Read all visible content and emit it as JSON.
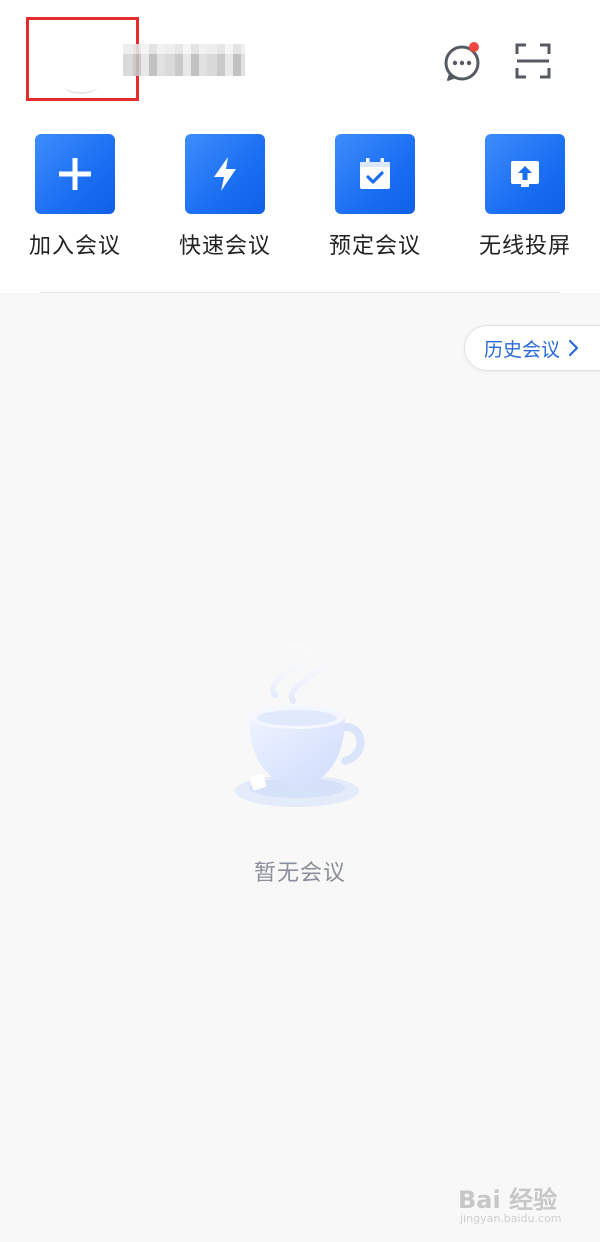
{
  "header": {
    "username": "████",
    "message_icon": "chat-bubble-icon",
    "scan_icon": "scan-icon"
  },
  "actions": [
    {
      "label": "加入会议",
      "icon": "plus-icon"
    },
    {
      "label": "快速会议",
      "icon": "lightning-icon"
    },
    {
      "label": "预定会议",
      "icon": "calendar-check-icon"
    },
    {
      "label": "无线投屏",
      "icon": "screen-share-icon"
    }
  ],
  "history": {
    "label": "历史会议"
  },
  "empty": {
    "text": "暂无会议"
  },
  "watermark": {
    "text": "Bai 经验",
    "sub": "jingyan.baidu.com"
  },
  "colors": {
    "accent": "#1a6ef2",
    "badge": "#f0483e",
    "history_text": "#2a6bd9",
    "highlight_box": "#e32d2d"
  }
}
